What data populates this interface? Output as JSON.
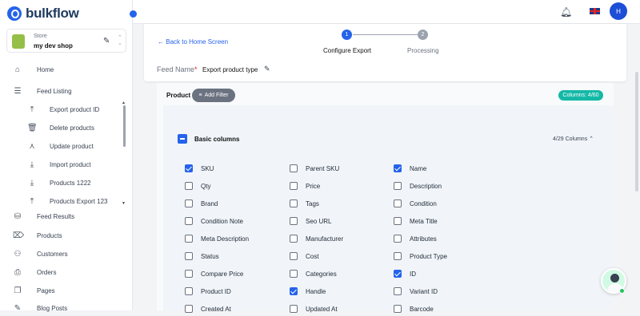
{
  "app": {
    "name": "bulkflow"
  },
  "store": {
    "label": "Store",
    "name": "my dev shop"
  },
  "sidebar": {
    "items": [
      {
        "label": "Home",
        "icon": "home-icon"
      },
      {
        "label": "Feed Listing",
        "icon": "list-icon"
      },
      {
        "label": "Export product ID",
        "icon": "upload-icon"
      },
      {
        "label": "Delete products",
        "icon": "trash-icon"
      },
      {
        "label": "Update product",
        "icon": "person-icon"
      },
      {
        "label": "Import product",
        "icon": "download-icon"
      },
      {
        "label": "Products 1222",
        "icon": "download-icon"
      },
      {
        "label": "Products Export 123",
        "icon": "upload-icon"
      },
      {
        "label": "Feed Results",
        "icon": "database-icon"
      },
      {
        "label": "Products",
        "icon": "tag-icon"
      },
      {
        "label": "Customers",
        "icon": "user-plus-icon"
      },
      {
        "label": "Orders",
        "icon": "inbox-icon"
      },
      {
        "label": "Pages",
        "icon": "pages-icon"
      },
      {
        "label": "Blog Posts",
        "icon": "edit-icon"
      }
    ]
  },
  "header": {
    "avatar_initial": "H"
  },
  "wizard": {
    "back_label": "Back to Home Screen",
    "steps": [
      {
        "number": "1",
        "label": "Configure Export"
      },
      {
        "number": "2",
        "label": "Processing"
      }
    ]
  },
  "feed": {
    "label": "Feed Name",
    "required_mark": "*",
    "value": "Export product type"
  },
  "product": {
    "label": "Product",
    "filter_label": "Add Filter",
    "columns_badge": "Columns: 4/60"
  },
  "section": {
    "title": "Basic columns",
    "count": "4/29 Columns",
    "columns": [
      {
        "label": "SKU",
        "checked": true
      },
      {
        "label": "Parent SKU",
        "checked": false
      },
      {
        "label": "Name",
        "checked": true
      },
      {
        "label": "Qty",
        "checked": false
      },
      {
        "label": "Price",
        "checked": false
      },
      {
        "label": "Description",
        "checked": false
      },
      {
        "label": "Brand",
        "checked": false
      },
      {
        "label": "Tags",
        "checked": false
      },
      {
        "label": "Condition",
        "checked": false
      },
      {
        "label": "Condition Note",
        "checked": false
      },
      {
        "label": "Seo URL",
        "checked": false
      },
      {
        "label": "Meta Title",
        "checked": false
      },
      {
        "label": "Meta Description",
        "checked": false
      },
      {
        "label": "Manufacturer",
        "checked": false
      },
      {
        "label": "Attributes",
        "checked": false
      },
      {
        "label": "Status",
        "checked": false
      },
      {
        "label": "Cost",
        "checked": false
      },
      {
        "label": "Product Type",
        "checked": false
      },
      {
        "label": "Compare Price",
        "checked": false
      },
      {
        "label": "Categories",
        "checked": false
      },
      {
        "label": "ID",
        "checked": true
      },
      {
        "label": "Product ID",
        "checked": false
      },
      {
        "label": "Handle",
        "checked": true
      },
      {
        "label": "Variant ID",
        "checked": false
      },
      {
        "label": "Created At",
        "checked": false
      },
      {
        "label": "Updated At",
        "checked": false
      },
      {
        "label": "Barcode",
        "checked": false
      }
    ]
  },
  "colors": {
    "accent": "#2563eb",
    "badge": "#14b8a6",
    "filter": "#6b7280"
  }
}
